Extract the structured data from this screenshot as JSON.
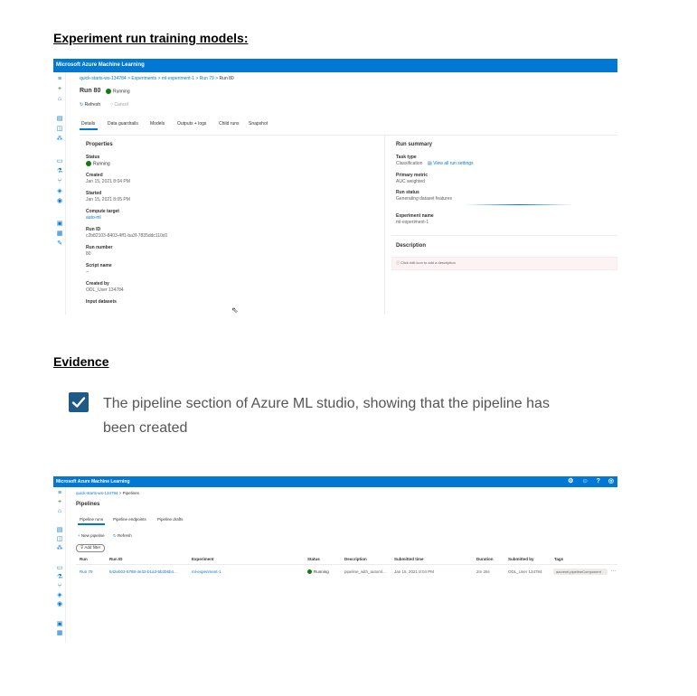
{
  "document": {
    "heading1": "Experiment run training models:",
    "heading2": "Evidence",
    "evidence_text": "The pipeline section of Azure ML studio, showing that the pipeline has been created"
  },
  "shot1": {
    "app_title": "Microsoft Azure Machine Learning",
    "breadcrumb": [
      "quick-starts-ws-134784",
      "Experiments",
      "ml-experiment-1",
      "Run 79",
      "Run 80"
    ],
    "run_title": "Run 80",
    "run_status": "Running",
    "refresh": "Refresh",
    "cancel": "Cancel",
    "tabs": [
      "Details",
      "Data guardrails",
      "Models",
      "Outputs + logs",
      "Child runs",
      "Snapshot"
    ],
    "properties_title": "Properties",
    "properties": [
      {
        "label": "Status",
        "value": "Running"
      },
      {
        "label": "Created",
        "value": "Jan 15, 2021 8:04 PM"
      },
      {
        "label": "Started",
        "value": "Jan 15, 2021 8:05 PM"
      },
      {
        "label": "Compute target",
        "value": "auto-ml"
      },
      {
        "label": "Run ID",
        "value": "c2b82103-8403-4ff1-ba3f-7835ddc110d1"
      },
      {
        "label": "Run number",
        "value": "80"
      },
      {
        "label": "Script name",
        "value": "--"
      },
      {
        "label": "Created by",
        "value": "ODL_User 134784"
      },
      {
        "label": "Input datasets",
        "value": ""
      }
    ],
    "summary_title": "Run summary",
    "task_type_label": "Task type",
    "task_type_value": "Classification",
    "view_settings": "View all run settings",
    "primary_metric_label": "Primary metric",
    "primary_metric_value": "AUC weighted",
    "run_status_label": "Run status",
    "run_status_value": "Generating dataset features",
    "experiment_label": "Experiment name",
    "experiment_value": "ml-experiment-1",
    "description_title": "Description",
    "description_hint": "Click edit icon to add a description"
  },
  "shot2": {
    "app_title": "Microsoft Azure Machine Learning",
    "breadcrumb": [
      "quick-starts-ws-134784",
      "Pipelines"
    ],
    "page_title": "Pipelines",
    "tabs": [
      "Pipeline runs",
      "Pipeline endpoints",
      "Pipeline drafts"
    ],
    "new_pipeline": "New pipeline",
    "refresh": "Refresh",
    "add_filter": "Add filter",
    "columns": [
      "Run",
      "Run ID",
      "Experiment",
      "Status",
      "Description",
      "Submitted time",
      "Duration",
      "Submitted by",
      "Tags"
    ],
    "row": [
      "Run 79",
      "642eb03-8788-4e32-b1a3-5b2b6b4...",
      "ml-experiment-1",
      "Running",
      "pipeline_with_automl...",
      "Jan 15, 2021 8:04 PM",
      "2m 26s",
      "ODL_User 134784",
      "azureml.pipelineComponent"
    ]
  }
}
